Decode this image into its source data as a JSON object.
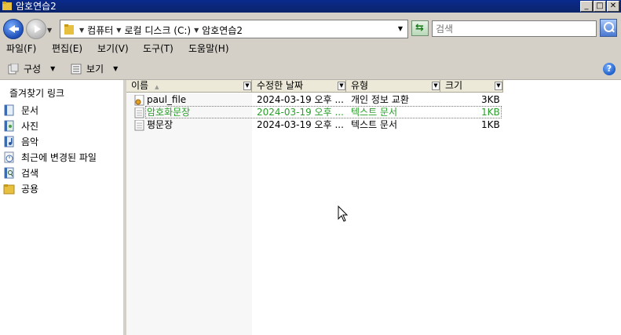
{
  "window": {
    "title": "암호연습2"
  },
  "address": {
    "crumbs": [
      "컴퓨터",
      "로컬 디스크 (C:)",
      "암호연습2"
    ],
    "search_placeholder": "검색"
  },
  "menu": [
    "파일(F)",
    "편집(E)",
    "보기(V)",
    "도구(T)",
    "도움말(H)"
  ],
  "toolbar": {
    "organize": "구성",
    "views": "보기"
  },
  "nav": {
    "header": "즐겨찾기 링크",
    "items": [
      {
        "label": "문서",
        "icon": "documents-icon"
      },
      {
        "label": "사진",
        "icon": "pictures-icon"
      },
      {
        "label": "음악",
        "icon": "music-icon"
      },
      {
        "label": "최근에 변경된 파일",
        "icon": "recent-files-icon"
      },
      {
        "label": "검색",
        "icon": "search-folder-icon"
      },
      {
        "label": "공용",
        "icon": "public-folder-icon"
      }
    ]
  },
  "columns": [
    "이름",
    "수정한 날짜",
    "유형",
    "크기"
  ],
  "files": [
    {
      "name": "paul_file",
      "date": "2024-03-19 오후 ...",
      "type": "개인 정보 교환",
      "size": "3KB",
      "icon": "certificate-file-icon",
      "selected": false
    },
    {
      "name": "암호화문장",
      "date": "2024-03-19 오후 ...",
      "type": "텍스트 문서",
      "size": "1KB",
      "icon": "text-file-icon",
      "selected": true
    },
    {
      "name": "평문장",
      "date": "2024-03-19 오후 ...",
      "type": "텍스트 문서",
      "size": "1KB",
      "icon": "text-file-icon",
      "selected": false
    }
  ],
  "colors": {
    "titlebar": "#0a246a",
    "chrome": "#d4d0c8",
    "selected_text": "#2aa02a"
  }
}
